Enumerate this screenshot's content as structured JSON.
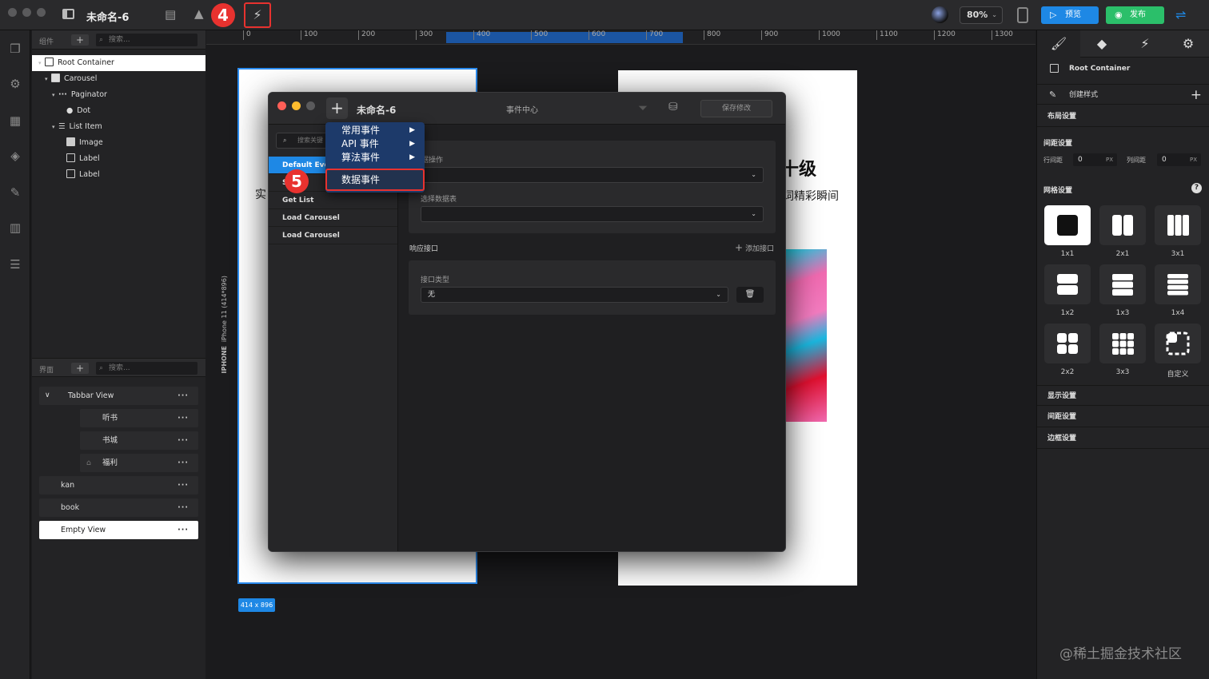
{
  "app": {
    "doc_title": "未命名-6",
    "zoom": "80%",
    "preview_label": "预览",
    "publish_label": "发布",
    "step4": "4",
    "step5": "5"
  },
  "components_panel": {
    "header_label": "组件",
    "search_placeholder": "搜索...",
    "tree": [
      {
        "label": "Root Container"
      },
      {
        "label": "Carousel"
      },
      {
        "label": "Paginator"
      },
      {
        "label": "Dot"
      },
      {
        "label": "List Item"
      },
      {
        "label": "Image"
      },
      {
        "label": "Label"
      },
      {
        "label": "Label"
      }
    ]
  },
  "pages_panel": {
    "header_label": "界面",
    "search_placeholder": "搜索...",
    "items": [
      {
        "label": "Tabbar View"
      },
      {
        "label": "听书"
      },
      {
        "label": "书城"
      },
      {
        "label": "福利"
      },
      {
        "label": "kan"
      },
      {
        "label": "book"
      },
      {
        "label": "Empty View"
      }
    ]
  },
  "ruler": {
    "ticks": [
      "0",
      "100",
      "200",
      "300",
      "400",
      "500",
      "600",
      "700",
      "800",
      "900",
      "1000",
      "1100",
      "1200",
      "1300"
    ]
  },
  "canvas": {
    "device_label": "IPHONE",
    "device_size_label": "iPhone 11 (414*896)",
    "size_badge": "414 x 896",
    "frame1_char": "实",
    "frame2_title_part": "十级",
    "frame2_subtitle_part": "词精彩瞬间"
  },
  "event_center": {
    "doc_title": "未命名-6",
    "title": "事件中心",
    "save_label": "保存修改",
    "search_placeholder": "搜索关键",
    "events": [
      {
        "label": "Default Even"
      },
      {
        "label": "S"
      },
      {
        "label": "Get List"
      },
      {
        "label": "Load Carousel"
      },
      {
        "label": "Load Carousel"
      }
    ],
    "data_op_label": "据操作",
    "select_table_label": "选择数据表",
    "response_label": "响应接口",
    "add_api_label": "添加接口",
    "api_type_label": "接口类型",
    "api_type_value": "无"
  },
  "dropdown_menu": {
    "items": [
      {
        "label": "常用事件"
      },
      {
        "label": "API 事件"
      },
      {
        "label": "算法事件"
      },
      {
        "label": "数据事件"
      }
    ]
  },
  "right_panel": {
    "selected_component": "Root Container",
    "create_style_label": "创建样式",
    "layout_label": "布局设置",
    "spacing_label": "间距设置",
    "row_gap_label": "行间距",
    "row_gap_value": "0",
    "col_gap_label": "列间距",
    "col_gap_value": "0",
    "unit": "PX",
    "grid_label": "网格设置",
    "grids": [
      {
        "label": "1x1"
      },
      {
        "label": "2x1"
      },
      {
        "label": "3x1"
      },
      {
        "label": "1x2"
      },
      {
        "label": "1x3"
      },
      {
        "label": "1x4"
      },
      {
        "label": "2x2"
      },
      {
        "label": "3x3"
      },
      {
        "label": "自定义"
      }
    ],
    "display_label": "显示设置",
    "spacing2_label": "间距设置",
    "border_label": "边框设置"
  },
  "watermark": "@稀土掘金技术社区",
  "colors": {
    "accent": "#1e88e5",
    "highlight": "#e8322f",
    "publish": "#2bbf6a"
  }
}
